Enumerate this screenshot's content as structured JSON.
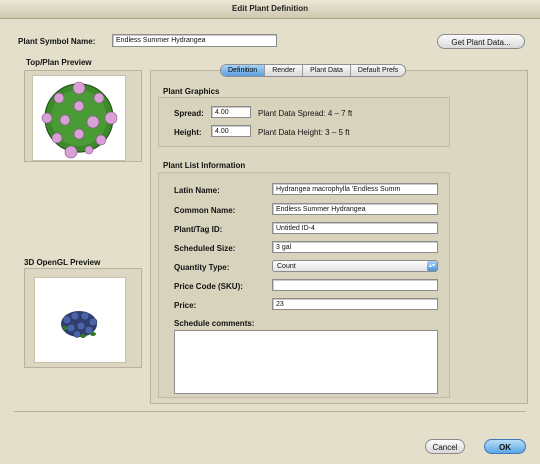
{
  "window": {
    "title": "Edit Plant Definition"
  },
  "header": {
    "plant_symbol_label": "Plant Symbol Name:",
    "plant_symbol_value": "Endless Summer Hydrangea",
    "get_plant_data_label": "Get Plant Data..."
  },
  "previews": {
    "top_label": "Top/Plan Preview",
    "opengl_label": "3D OpenGL Preview"
  },
  "tabs": [
    {
      "label": "Definition",
      "active": true
    },
    {
      "label": "Render",
      "active": false
    },
    {
      "label": "Plant Data",
      "active": false
    },
    {
      "label": "Default Prefs",
      "active": false
    }
  ],
  "graphics": {
    "title": "Plant Graphics",
    "spread_label": "Spread:",
    "spread_value": "4.00",
    "spread_data": "Plant Data Spread: 4 – 7 ft",
    "height_label": "Height:",
    "height_value": "4.00",
    "height_data": "Plant Data Height: 3 – 5 ft"
  },
  "plantlist": {
    "title": "Plant List Information",
    "latin_label": "Latin Name:",
    "latin_value": "Hydrangea macrophylla 'Endless Summ",
    "common_label": "Common Name:",
    "common_value": "Endless Summer Hydrangea",
    "tag_label": "Plant/Tag ID:",
    "tag_value": "Untitled ID-4",
    "size_label": "Scheduled Size:",
    "size_value": "3 gal",
    "qty_label": "Quantity Type:",
    "qty_value": "Count",
    "price_code_label": "Price Code (SKU):",
    "price_code_value": "",
    "price_label": "Price:",
    "price_value": "23",
    "comments_label": "Schedule comments:"
  },
  "footer": {
    "cancel_label": "Cancel",
    "ok_label": "OK"
  },
  "colors": {
    "accent": "#5aa7e6",
    "plant_green": "#3a8a2a",
    "flower_pink": "#d9a0d8"
  }
}
